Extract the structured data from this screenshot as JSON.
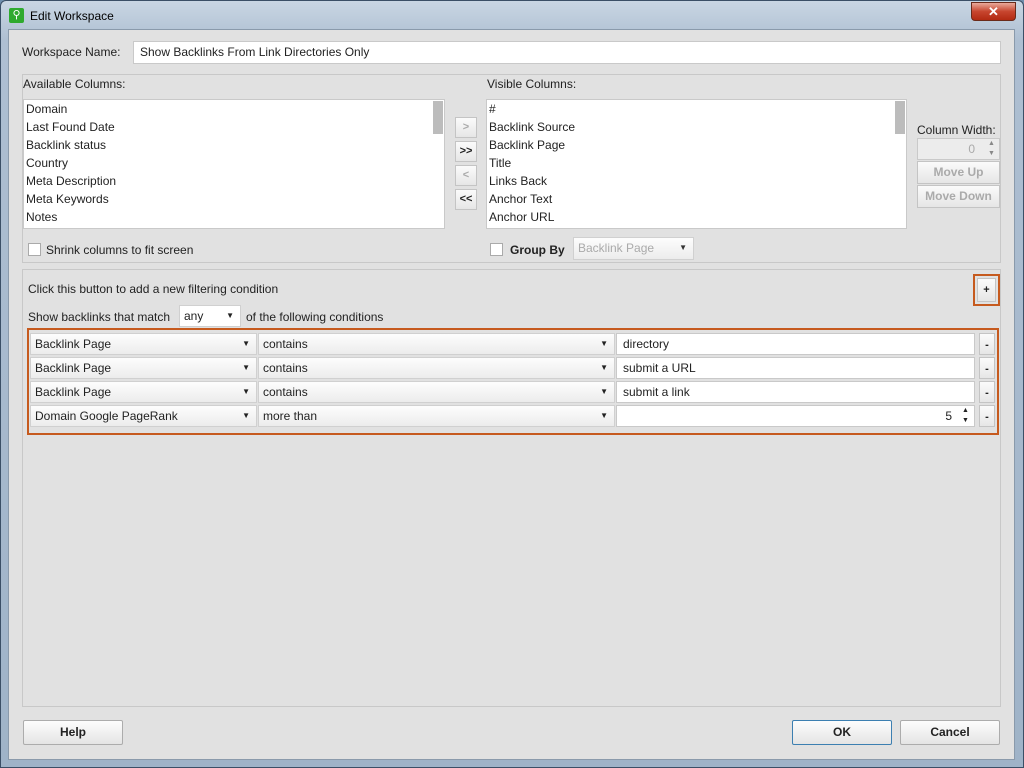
{
  "window": {
    "title": "Edit Workspace",
    "close_glyph": "✕",
    "icon": "search-icon"
  },
  "workspace": {
    "label": "Workspace Name:",
    "value": "Show Backlinks From Link Directories Only"
  },
  "available": {
    "label": "Available Columns:",
    "items": [
      "Domain",
      "Last Found Date",
      "Backlink status",
      "Country",
      "Meta Description",
      "Meta Keywords",
      "Notes"
    ]
  },
  "visible": {
    "label": "Visible Columns:",
    "items": [
      "#",
      "Backlink Source",
      "Backlink Page",
      "Title",
      "Links Back",
      "Anchor Text",
      "Anchor URL"
    ]
  },
  "arrows": {
    "add": ">",
    "add_all": ">>",
    "remove": "<",
    "remove_all": "<<"
  },
  "column_width": {
    "label": "Column Width:",
    "value": "0",
    "move_up": "Move Up",
    "move_down": "Move Down"
  },
  "shrink": {
    "label": "Shrink columns to fit screen",
    "checked": false
  },
  "group_by": {
    "label": "Group By",
    "checked": false,
    "value": "Backlink Page"
  },
  "filter": {
    "hint": "Click this button to add a new filtering condition",
    "add": "+",
    "match_prefix": "Show backlinks that match",
    "match_value": "any",
    "match_suffix": "of the following conditions",
    "conditions": [
      {
        "field": "Backlink Page",
        "op": "contains",
        "value": "directory",
        "remove": "-"
      },
      {
        "field": "Backlink Page",
        "op": "contains",
        "value": "submit a URL",
        "remove": "-"
      },
      {
        "field": "Backlink Page",
        "op": "contains",
        "value": "submit a link",
        "remove": "-"
      },
      {
        "field": "Domain Google PageRank",
        "op": "more than",
        "value": "5",
        "remove": "-"
      }
    ]
  },
  "buttons": {
    "help": "Help",
    "ok": "OK",
    "cancel": "Cancel"
  },
  "colors": {
    "highlight": "#c65a1e",
    "close": "#c7452e"
  }
}
